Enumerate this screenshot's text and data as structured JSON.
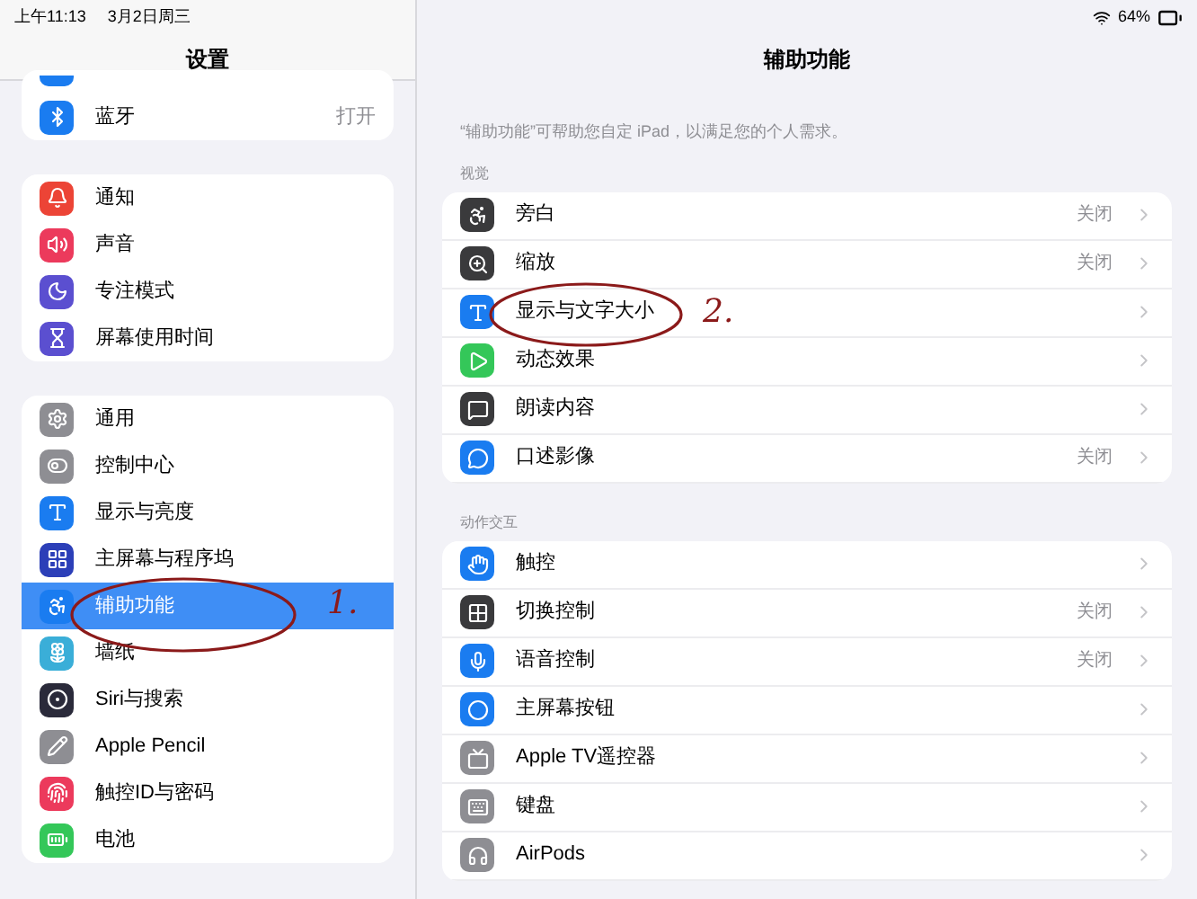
{
  "status_bar": {
    "time": "上午11:13",
    "date": "3月2日周三",
    "battery": "64%"
  },
  "sidebar": {
    "title": "设置",
    "groups": [
      {
        "items": [
          {
            "kind": "partial",
            "color": "#1a7cf0",
            "selected": false
          },
          {
            "label": "蓝牙",
            "value": "打开",
            "color": "#1a7cf0",
            "selected": false
          }
        ]
      },
      {
        "items": [
          {
            "label": "通知",
            "color": "#ec4436",
            "selected": false
          },
          {
            "label": "声音",
            "color": "#ec3a5c",
            "selected": false
          },
          {
            "label": "专注模式",
            "color": "#5b4fd0",
            "selected": false
          },
          {
            "label": "屏幕使用时间",
            "color": "#5b4fd0",
            "selected": false
          }
        ]
      },
      {
        "items": [
          {
            "label": "通用",
            "color": "#8e8e93",
            "selected": false
          },
          {
            "label": "控制中心",
            "color": "#8e8e93",
            "selected": false
          },
          {
            "label": "显示与亮度",
            "color": "#1a7cf0",
            "selected": false
          },
          {
            "label": "主屏幕与程序坞",
            "color": "#2c3fb8",
            "selected": false
          },
          {
            "label": "辅助功能",
            "color": "#1a7cf0",
            "selected": true
          },
          {
            "label": "墙纸",
            "color": "#3aaed8",
            "selected": false
          },
          {
            "label": "Siri与搜索",
            "color": "#2a2a3a",
            "selected": false
          },
          {
            "label": "Apple Pencil",
            "color": "#8e8e93",
            "selected": false
          },
          {
            "label": "触控ID与密码",
            "color": "#ec3a5c",
            "selected": false
          },
          {
            "label": "电池",
            "color": "#34c759",
            "selected": false
          }
        ]
      }
    ]
  },
  "detail": {
    "title": "辅助功能",
    "description": "“辅助功能”可帮助您自定 iPad，以满足您的个人需求。",
    "sections": [
      {
        "header": "视觉",
        "items": [
          {
            "label": "旁白",
            "value": "关闭",
            "color": "#3a3a3c"
          },
          {
            "label": "缩放",
            "value": "关闭",
            "color": "#3a3a3c"
          },
          {
            "label": "显示与文字大小",
            "color": "#1a7cf0"
          },
          {
            "label": "动态效果",
            "color": "#34c759"
          },
          {
            "label": "朗读内容",
            "color": "#3a3a3c"
          },
          {
            "label": "口述影像",
            "value": "关闭",
            "color": "#1a7cf0"
          }
        ]
      },
      {
        "header": "动作交互",
        "items": [
          {
            "label": "触控",
            "color": "#1a7cf0"
          },
          {
            "label": "切换控制",
            "value": "关闭",
            "color": "#3a3a3c"
          },
          {
            "label": "语音控制",
            "value": "关闭",
            "color": "#1a7cf0"
          },
          {
            "label": "主屏幕按钮",
            "color": "#1a7cf0"
          },
          {
            "label": "Apple TV遥控器",
            "color": "#8e8e93"
          },
          {
            "label": "键盘",
            "color": "#8e8e93"
          },
          {
            "label": "AirPods",
            "color": "#8e8e93"
          }
        ]
      }
    ]
  },
  "annotations": [
    {
      "label": "1."
    },
    {
      "label": "2."
    }
  ]
}
